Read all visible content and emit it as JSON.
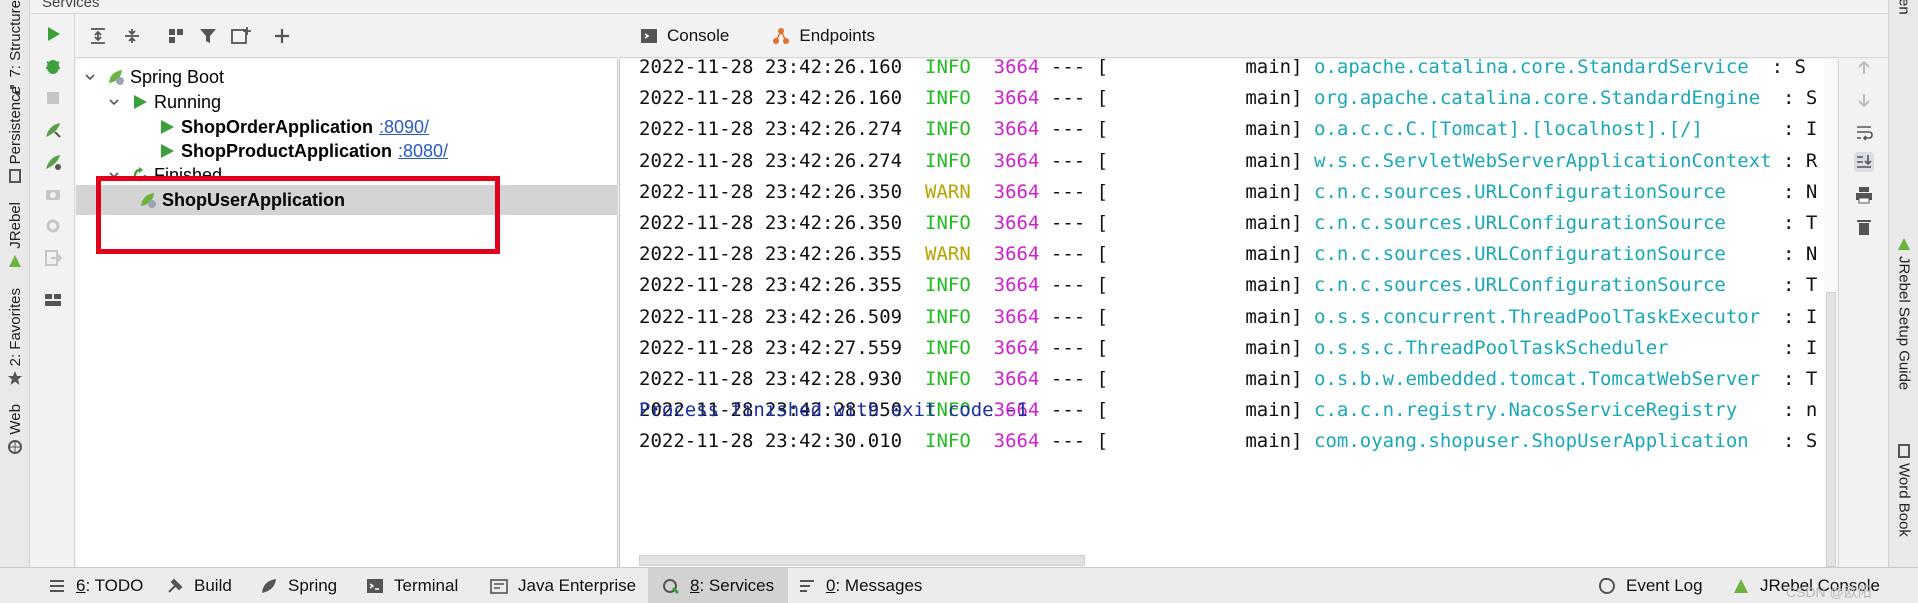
{
  "panel": {
    "title": "Services"
  },
  "left_strip": {
    "tabs": [
      {
        "label": "7: Structure",
        "icon": "structure-icon"
      },
      {
        "label": "Persistence",
        "icon": "persistence-icon"
      },
      {
        "label": "JRebel",
        "icon": "jrebel-icon"
      },
      {
        "label": "2: Favorites",
        "icon": "star-icon"
      },
      {
        "label": "Web",
        "icon": "web-icon"
      }
    ]
  },
  "right_strip": {
    "tabs": [
      {
        "label": "JRebel Setup Guide",
        "icon": "jrebel-icon"
      },
      {
        "label": "Word Book",
        "icon": "book-icon"
      }
    ],
    "top_fragment": "en"
  },
  "service_toolbar": {
    "icons": [
      "run-icon",
      "debug-icon",
      "stop-icon",
      "deploy-icon",
      "debug-deploy-icon",
      "snapshot-icon",
      "settings-icon",
      "exit-icon",
      "layout-icon"
    ]
  },
  "tree_toolbar": {
    "icons": [
      "expand-all-icon",
      "collapse-all-icon",
      "group-icon",
      "filter-icon",
      "new-service-icon",
      "add-icon"
    ]
  },
  "tree": {
    "root": {
      "label": "Spring Boot",
      "icon": "spring-boot-icon"
    },
    "running": {
      "label": "Running",
      "apps": [
        {
          "name": "ShopOrderApplication",
          "port": ":8090/"
        },
        {
          "name": "ShopProductApplication",
          "port": ":8080/"
        }
      ]
    },
    "finished": {
      "label": "Finished",
      "apps": [
        {
          "name": "ShopUserApplication"
        }
      ]
    }
  },
  "console_tabs": [
    {
      "label": "Console",
      "icon": "console-icon"
    },
    {
      "label": "Endpoints",
      "icon": "endpoints-icon"
    }
  ],
  "console": {
    "lines": [
      {
        "ts": "2022-11-28 23:42:26.160",
        "level": "INFO",
        "pid": "3664",
        "sep": "--- [",
        "thread": "           main]",
        "logger": "o.apache.catalina.core.StandardService ",
        "msg": ": S"
      },
      {
        "ts": "2022-11-28 23:42:26.160",
        "level": "INFO",
        "pid": "3664",
        "sep": "--- [",
        "thread": "           main]",
        "logger": "org.apache.catalina.core.StandardEngine ",
        "msg": ": S"
      },
      {
        "ts": "2022-11-28 23:42:26.274",
        "level": "INFO",
        "pid": "3664",
        "sep": "--- [",
        "thread": "           main]",
        "logger": "o.a.c.c.C.[Tomcat].[localhost].[/]      ",
        "msg": ": I"
      },
      {
        "ts": "2022-11-28 23:42:26.274",
        "level": "INFO",
        "pid": "3664",
        "sep": "--- [",
        "thread": "           main]",
        "logger": "w.s.c.ServletWebServerApplicationContext",
        "msg": ": R"
      },
      {
        "ts": "2022-11-28 23:42:26.350",
        "level": "WARN",
        "pid": "3664",
        "sep": "--- [",
        "thread": "           main]",
        "logger": "c.n.c.sources.URLConfigurationSource    ",
        "msg": ": N"
      },
      {
        "ts": "2022-11-28 23:42:26.350",
        "level": "INFO",
        "pid": "3664",
        "sep": "--- [",
        "thread": "           main]",
        "logger": "c.n.c.sources.URLConfigurationSource    ",
        "msg": ": T"
      },
      {
        "ts": "2022-11-28 23:42:26.355",
        "level": "WARN",
        "pid": "3664",
        "sep": "--- [",
        "thread": "           main]",
        "logger": "c.n.c.sources.URLConfigurationSource    ",
        "msg": ": N"
      },
      {
        "ts": "2022-11-28 23:42:26.355",
        "level": "INFO",
        "pid": "3664",
        "sep": "--- [",
        "thread": "           main]",
        "logger": "c.n.c.sources.URLConfigurationSource    ",
        "msg": ": T"
      },
      {
        "ts": "2022-11-28 23:42:26.509",
        "level": "INFO",
        "pid": "3664",
        "sep": "--- [",
        "thread": "           main]",
        "logger": "o.s.s.concurrent.ThreadPoolTaskExecutor ",
        "msg": ": I"
      },
      {
        "ts": "2022-11-28 23:42:27.559",
        "level": "INFO",
        "pid": "3664",
        "sep": "--- [",
        "thread": "           main]",
        "logger": "o.s.s.c.ThreadPoolTaskScheduler         ",
        "msg": ": I"
      },
      {
        "ts": "2022-11-28 23:42:28.930",
        "level": "INFO",
        "pid": "3664",
        "sep": "--- [",
        "thread": "           main]",
        "logger": "o.s.b.w.embedded.tomcat.TomcatWebServer ",
        "msg": ": T"
      },
      {
        "ts": "2022-11-28 23:42:28.950",
        "level": "INFO",
        "pid": "3664",
        "sep": "--- [",
        "thread": "           main]",
        "logger": "c.a.c.n.registry.NacosServiceRegistry   ",
        "msg": ": n"
      },
      {
        "ts": "2022-11-28 23:42:30.010",
        "level": "INFO",
        "pid": "3664",
        "sep": "--- [",
        "thread": "           main]",
        "logger": "com.oyang.shopuser.ShopUserApplication  ",
        "msg": ": S"
      }
    ],
    "exit_message": "Process finished with exit code -1"
  },
  "console_side": {
    "icons": [
      "up-arrow-icon",
      "down-arrow-icon",
      "soft-wrap-icon",
      "scroll-to-end-icon",
      "print-icon",
      "trash-icon"
    ]
  },
  "bottom_bar": {
    "items": [
      {
        "key": "6",
        "label": ": TODO",
        "icon": "todo-icon"
      },
      {
        "key": "",
        "label": "Build",
        "icon": "hammer-icon"
      },
      {
        "key": "",
        "label": "Spring",
        "icon": "spring-leaf-icon"
      },
      {
        "key": "",
        "label": "Terminal",
        "icon": "terminal-icon"
      },
      {
        "key": "",
        "label": "Java Enterprise",
        "icon": "java-enterprise-icon"
      },
      {
        "key": "8",
        "label": ": Services",
        "icon": "services-icon",
        "active": true
      },
      {
        "key": "0",
        "label": ": Messages",
        "icon": "messages-icon"
      },
      {
        "key": "",
        "label": "Event Log",
        "icon": "event-log-icon"
      },
      {
        "key": "",
        "label": "JRebel Console",
        "icon": "jrebel-icon"
      }
    ],
    "watermark": "CSDN @欧阳"
  },
  "colors": {
    "highlight": "#e0001b",
    "info": "#22bb22",
    "warn": "#b8a200",
    "pid": "#cc22cc",
    "logger": "#1aa7b8",
    "exit": "#1e2fa0",
    "link": "#2b59c3",
    "spring_green": "#6db33f"
  }
}
